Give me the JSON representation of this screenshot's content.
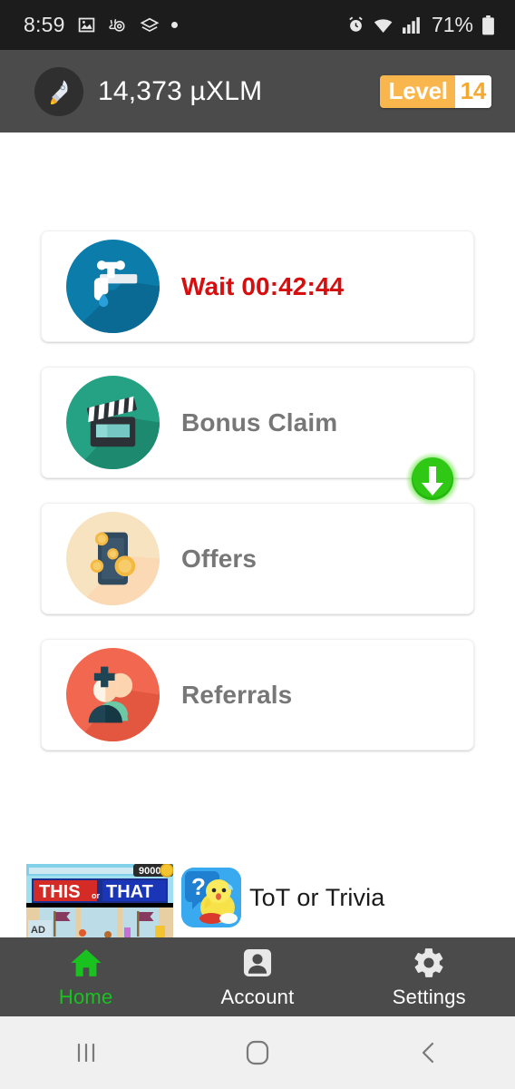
{
  "status_bar": {
    "time": "8:59",
    "battery_percent": "71%",
    "left_icons": [
      "image-icon",
      "snail-icon",
      "layers-icon",
      "dot-icon"
    ],
    "right_icons": [
      "alarm-icon",
      "wifi-icon",
      "signal-icon",
      "battery-icon"
    ],
    "background": "#1c1c1c"
  },
  "app_bar": {
    "balance": "14,373 µXLM",
    "avatar_icon": "rocket-icon",
    "level_word": "Level",
    "level_number": "14",
    "badge_color": "#f9b64d",
    "background": "#4b4b4b"
  },
  "cards": [
    {
      "label": "Wait 00:42:44",
      "icon": "faucet-icon",
      "icon_bg": "#0c7cab",
      "label_color": "#d50f0f",
      "name": "faucet-claim-card"
    },
    {
      "label": "Bonus Claim",
      "icon": "clapperboard-icon",
      "icon_bg": "#24a283",
      "label_color": "#777777",
      "name": "bonus-claim-card"
    },
    {
      "label": "Offers",
      "icon": "phone-coins-icon",
      "icon_bg": "#f7e3bf",
      "label_color": "#777777",
      "name": "offers-card"
    },
    {
      "label": "Referrals",
      "icon": "add-person-icon",
      "icon_bg": "#f2674f",
      "label_color": "#777777",
      "name": "referrals-card"
    }
  ],
  "ad": {
    "title": "ToT or Trivia",
    "banner_label": "AD",
    "banner_headline_left": "THIS",
    "banner_headline_mid": "or",
    "banner_headline_right": "THAT",
    "banner_score": "9000",
    "download_icon": "download-arrow-icon",
    "download_color": "#2ecc13",
    "app_icon": "chick-question-icon"
  },
  "bottom_nav": {
    "items": [
      {
        "label": "Home",
        "icon": "home-icon",
        "active": true
      },
      {
        "label": "Account",
        "icon": "person-icon",
        "active": false
      },
      {
        "label": "Settings",
        "icon": "gear-icon",
        "active": false
      }
    ],
    "active_color": "#19c21f",
    "background": "#4b4b4b"
  },
  "system_nav": {
    "recents_icon": "recents-icon",
    "home_icon": "home-square-icon",
    "back_icon": "back-chevron-icon",
    "background": "#f0f0f0"
  }
}
